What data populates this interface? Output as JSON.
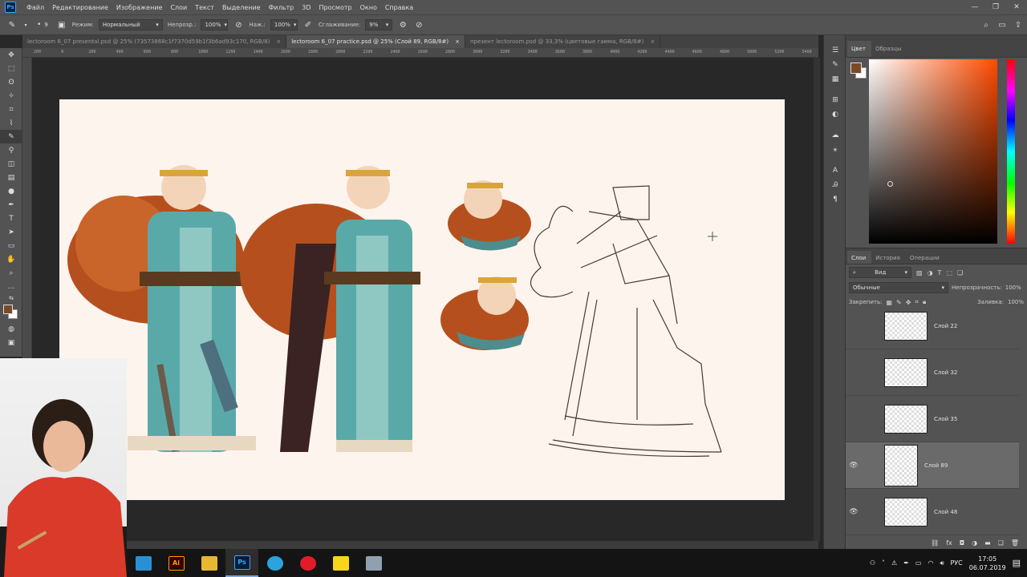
{
  "menubar": {
    "app_logo": "Ps",
    "items": [
      "Файл",
      "Редактирование",
      "Изображение",
      "Слои",
      "Текст",
      "Выделение",
      "Фильтр",
      "3D",
      "Просмотр",
      "Окно",
      "Справка"
    ]
  },
  "options": {
    "brush_size": "9",
    "mode_label": "Режим:",
    "mode_value": "Нормальный",
    "opacity_label": "Непрозр.:",
    "opacity_value": "100%",
    "pressure_label": "Наж.:",
    "pressure_value": "100%",
    "smoothing_label": "Сглаживание:",
    "smoothing_value": "9%"
  },
  "tabs": [
    {
      "label": "lectoroom 6_07 presental.psd @ 25% (73573868c1f7370d59b1f3b6ad93c170, RGB/8)",
      "close": "×"
    },
    {
      "label": "lectoroom 6_07 practice.psd @ 25% (Слой 89, RGB/8#)",
      "close": "×"
    },
    {
      "label": "презент lectoroom.psd @ 33,3% (цветовые гамма, RGB/8#)",
      "close": "×"
    }
  ],
  "ruler": {
    "ticks": [
      "200",
      "0",
      "200",
      "400",
      "600",
      "800",
      "1000",
      "1200",
      "1400",
      "1600",
      "1800",
      "2000",
      "2200",
      "2400",
      "2600",
      "2800",
      "3000",
      "3200",
      "3400",
      "3600",
      "3800",
      "4000",
      "4200",
      "4400",
      "4600",
      "4800",
      "5000",
      "5200",
      "5400"
    ]
  },
  "color_panel": {
    "tabs": [
      "Цвет",
      "Образцы"
    ],
    "foreground_color": "#7a4a28",
    "background_color": "#ffffff"
  },
  "layers_panel": {
    "tabs": [
      "Слои",
      "История",
      "Операции"
    ],
    "filter_label": "Вид",
    "blend_mode": "Обычные",
    "opacity_label": "Непрозрачность:",
    "opacity_value": "100%",
    "lock_label": "Закрепить:",
    "fill_label": "Заливка:",
    "fill_value": "100%",
    "layers": [
      {
        "name": "Слой 22",
        "visible": false
      },
      {
        "name": "Слой 32",
        "visible": false
      },
      {
        "name": "Слой 35",
        "visible": false
      },
      {
        "name": "Слой 89",
        "visible": true,
        "selected": true
      },
      {
        "name": "Слой 48",
        "visible": true
      }
    ]
  },
  "taskbar": {
    "apps": [
      {
        "name": "explorer-files",
        "label": "",
        "bg": "#2b8fd6",
        "fg": "#fff"
      },
      {
        "name": "illustrator",
        "label": "Ai",
        "bg": "#330000",
        "fg": "#ff9a00"
      },
      {
        "name": "folder",
        "label": "",
        "bg": "#e8b730",
        "fg": "#fff"
      },
      {
        "name": "photoshop",
        "label": "Ps",
        "bg": "#001e36",
        "fg": "#31a8ff"
      },
      {
        "name": "telegram",
        "label": "",
        "bg": "#2aa3df",
        "fg": "#fff"
      },
      {
        "name": "opera",
        "label": "",
        "bg": "#e01c2a",
        "fg": "#fff"
      },
      {
        "name": "sticky-notes",
        "label": "",
        "bg": "#f7d51d",
        "fg": "#333"
      },
      {
        "name": "storage",
        "label": "",
        "bg": "#8fa0b0",
        "fg": "#fff"
      }
    ],
    "language": "РУС",
    "time": "17:05",
    "date": "06.07.2019"
  }
}
